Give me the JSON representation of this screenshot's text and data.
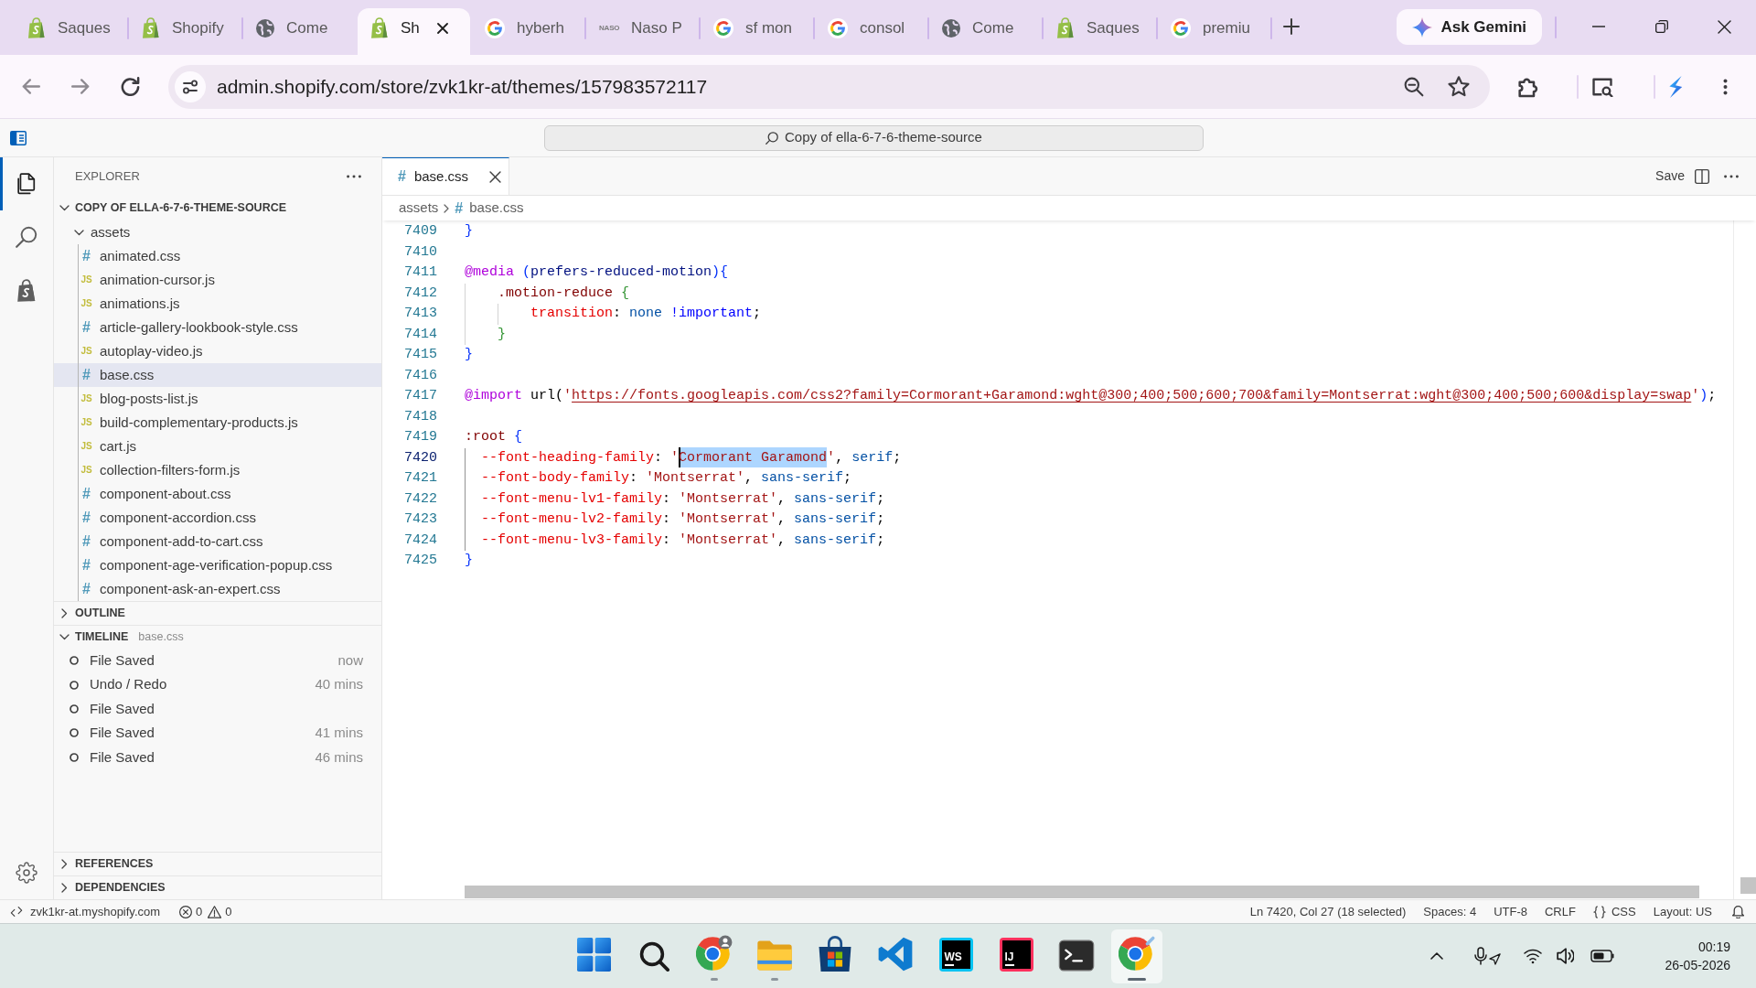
{
  "browser": {
    "tabs": [
      {
        "kind": "shopify",
        "title": "Saques",
        "selected": false
      },
      {
        "kind": "shopify",
        "title": "Shopify",
        "selected": false
      },
      {
        "kind": "globe",
        "title": "Come",
        "selected": false
      },
      {
        "kind": "shopify",
        "title": "Sh",
        "selected": true
      },
      {
        "kind": "google",
        "title": "hyberh",
        "selected": false
      },
      {
        "kind": "wordmark",
        "logo_text": "NASO",
        "title": "Naso P",
        "selected": false
      },
      {
        "kind": "google",
        "title": "sf mon",
        "selected": false
      },
      {
        "kind": "google",
        "title": "consol",
        "selected": false
      },
      {
        "kind": "globe",
        "title": "Come",
        "selected": false
      },
      {
        "kind": "shopify",
        "title": "Saques",
        "selected": false
      },
      {
        "kind": "google",
        "title": "premiu",
        "selected": false
      }
    ],
    "gemini_button": "Ask Gemini",
    "navigation": [
      {
        "kind": "back",
        "disabled": true
      },
      {
        "kind": "forward",
        "disabled": true
      },
      {
        "kind": "reload",
        "disabled": false
      }
    ],
    "address": "admin.shopify.com/store/zvk1kr-at/themes/157983572117"
  },
  "title_bar": {
    "search": "Copy of ella-6-7-6-theme-source"
  },
  "activity_bar": [
    {
      "kind": "explorer",
      "selected": true
    },
    {
      "kind": "search",
      "selected": false
    },
    {
      "kind": "store",
      "selected": false
    }
  ],
  "sidebar": {
    "title": "EXPLORER",
    "tree": {
      "name": "COPY OF ELLA-6-7-6-THEME-SOURCE",
      "expanded": true,
      "children": [
        {
          "name": "assets",
          "expanded": true,
          "children": [
            {
              "name": "animated.css",
              "kind": "css",
              "glyph": "#",
              "selected": false
            },
            {
              "name": "animation-cursor.js",
              "kind": "js",
              "glyph": "JS",
              "selected": false
            },
            {
              "name": "animations.js",
              "kind": "js",
              "glyph": "JS",
              "selected": false
            },
            {
              "name": "article-gallery-lookbook-style.css",
              "kind": "css",
              "glyph": "#",
              "selected": false
            },
            {
              "name": "autoplay-video.js",
              "kind": "js",
              "glyph": "JS",
              "selected": false
            },
            {
              "name": "base.css",
              "kind": "css",
              "glyph": "#",
              "selected": true
            },
            {
              "name": "blog-posts-list.js",
              "kind": "js",
              "glyph": "JS",
              "selected": false
            },
            {
              "name": "build-complementary-products.js",
              "kind": "js",
              "glyph": "JS",
              "selected": false
            },
            {
              "name": "cart.js",
              "kind": "js",
              "glyph": "JS",
              "selected": false
            },
            {
              "name": "collection-filters-form.js",
              "kind": "js",
              "glyph": "JS",
              "selected": false
            },
            {
              "name": "component-about.css",
              "kind": "css",
              "glyph": "#",
              "selected": false
            },
            {
              "name": "component-accordion.css",
              "kind": "css",
              "glyph": "#",
              "selected": false
            },
            {
              "name": "component-add-to-cart.css",
              "kind": "css",
              "glyph": "#",
              "selected": false
            },
            {
              "name": "component-age-verification-popup.css",
              "kind": "css",
              "glyph": "#",
              "selected": false
            },
            {
              "name": "component-ask-an-expert.css",
              "kind": "css",
              "glyph": "#",
              "selected": false
            }
          ]
        }
      ]
    },
    "sections": [
      {
        "title": "OUTLINE",
        "expanded": false
      },
      {
        "title": "TIMELINE",
        "subtitle": "base.css",
        "expanded": true,
        "items": [
          {
            "label": "File Saved",
            "time": "now"
          },
          {
            "label": "Undo / Redo",
            "time": "40 mins"
          },
          {
            "label": "File Saved"
          },
          {
            "label": "File Saved",
            "time": "41 mins"
          },
          {
            "label": "File Saved",
            "time": "46 mins"
          }
        ]
      },
      {
        "title": "REFERENCES",
        "expanded": false
      },
      {
        "title": "DEPENDENCIES",
        "expanded": false
      }
    ]
  },
  "editor": {
    "tabs": [
      {
        "title": "base.css",
        "kind": "css",
        "glyph": "#",
        "selected": true
      }
    ],
    "save_button": "Save",
    "breadcrumb": [
      {
        "text": "assets",
        "kind": "folder"
      },
      {
        "text": "base.css",
        "kind": "css",
        "glyph": "#"
      }
    ],
    "lines": [
      {
        "number": "7409",
        "current": false,
        "tokens": [
          {
            "text": "}",
            "kind": "bracket1"
          }
        ]
      },
      {
        "number": "7410",
        "current": false
      },
      {
        "number": "7411",
        "current": false,
        "tokens": [
          {
            "text": "@media",
            "kind": "at-rule"
          },
          {
            "text": " (",
            "kind": "bracket1"
          },
          {
            "text": "prefers-reduced-motion",
            "kind": "ident"
          },
          {
            "text": ")",
            "kind": "bracket1"
          },
          {
            "text": "{",
            "kind": "bracket1"
          }
        ]
      },
      {
        "number": "7412",
        "current": false,
        "tokens": [
          {
            "text": "    .motion-reduce ",
            "kind": "selector"
          },
          {
            "text": "{",
            "kind": "bracket2"
          }
        ]
      },
      {
        "number": "7413",
        "current": false,
        "tokens": [
          {
            "text": "        transition",
            "kind": "property"
          },
          {
            "text": ": ",
            "kind": "punct"
          },
          {
            "text": "none ",
            "kind": "value"
          },
          {
            "text": "!important",
            "kind": "keyword"
          },
          {
            "text": ";",
            "kind": "punct"
          }
        ]
      },
      {
        "number": "7414",
        "current": false,
        "tokens": [
          {
            "text": "    }",
            "kind": "bracket2"
          }
        ]
      },
      {
        "number": "7415",
        "current": false,
        "tokens": [
          {
            "text": "}",
            "kind": "bracket1"
          }
        ]
      },
      {
        "number": "7416",
        "current": false
      },
      {
        "number": "7417",
        "current": false,
        "tokens": [
          {
            "text": "@import",
            "kind": "at-rule"
          },
          {
            "text": " url(",
            "kind": "punct"
          },
          {
            "text": "'",
            "kind": "string"
          },
          {
            "text": "https://fonts.googleapis.com/css2?family=Cormorant+Garamond:wght@300;400;500;600;700&family=Montserrat:wght@300;400;500;600&display=swap",
            "kind": "link"
          },
          {
            "text": "'",
            "kind": "string"
          },
          {
            "text": ")",
            "kind": "bracket1"
          },
          {
            "text": ";",
            "kind": "punct"
          }
        ]
      },
      {
        "number": "7418",
        "current": false
      },
      {
        "number": "7419",
        "current": false,
        "tokens": [
          {
            "text": ":root ",
            "kind": "selector"
          },
          {
            "text": "{",
            "kind": "bracket1"
          }
        ]
      },
      {
        "number": "7420",
        "current": true,
        "tokens": [
          {
            "text": "  --font-heading-family",
            "kind": "property",
            "selected": false
          },
          {
            "text": ": ",
            "kind": "punct",
            "selected": false
          },
          {
            "text": "'",
            "kind": "string",
            "selected": false
          },
          {
            "text": "Cormorant Garamond",
            "kind": "string",
            "selected": true
          },
          {
            "text": "'",
            "kind": "string",
            "selected": false
          },
          {
            "text": ", ",
            "kind": "punct",
            "selected": false
          },
          {
            "text": "serif",
            "kind": "value",
            "selected": false
          },
          {
            "text": ";",
            "kind": "punct",
            "selected": false
          }
        ]
      },
      {
        "number": "7421",
        "current": false,
        "tokens": [
          {
            "text": "  --font-body-family",
            "kind": "property"
          },
          {
            "text": ": ",
            "kind": "punct"
          },
          {
            "text": "'Montserrat'",
            "kind": "string"
          },
          {
            "text": ", ",
            "kind": "punct"
          },
          {
            "text": "sans-serif",
            "kind": "value"
          },
          {
            "text": ";",
            "kind": "punct"
          }
        ]
      },
      {
        "number": "7422",
        "current": false,
        "tokens": [
          {
            "text": "  --font-menu-lv1-family",
            "kind": "property"
          },
          {
            "text": ": ",
            "kind": "punct"
          },
          {
            "text": "'Montserrat'",
            "kind": "string"
          },
          {
            "text": ", ",
            "kind": "punct"
          },
          {
            "text": "sans-serif",
            "kind": "value"
          },
          {
            "text": ";",
            "kind": "punct"
          }
        ]
      },
      {
        "number": "7423",
        "current": false,
        "tokens": [
          {
            "text": "  --font-menu-lv2-family",
            "kind": "property"
          },
          {
            "text": ": ",
            "kind": "punct"
          },
          {
            "text": "'Montserrat'",
            "kind": "string"
          },
          {
            "text": ", ",
            "kind": "punct"
          },
          {
            "text": "sans-serif",
            "kind": "value"
          },
          {
            "text": ";",
            "kind": "punct"
          }
        ]
      },
      {
        "number": "7424",
        "current": false,
        "tokens": [
          {
            "text": "  --font-menu-lv3-family",
            "kind": "property"
          },
          {
            "text": ": ",
            "kind": "punct"
          },
          {
            "text": "'Montserrat'",
            "kind": "string"
          },
          {
            "text": ", ",
            "kind": "punct"
          },
          {
            "text": "sans-serif",
            "kind": "value"
          },
          {
            "text": ";",
            "kind": "punct"
          }
        ]
      },
      {
        "number": "7425",
        "current": false,
        "tokens": [
          {
            "text": "}",
            "kind": "bracket1"
          }
        ]
      }
    ]
  },
  "status_bar": {
    "remote": "zvk1kr-at.myshopify.com",
    "errors": "0",
    "warnings": "0",
    "items": [
      {
        "kind": "text",
        "text": "Ln 7420, Col 27 (18 selected)"
      },
      {
        "kind": "text",
        "text": "Spaces: 4"
      },
      {
        "kind": "text",
        "text": "UTF-8"
      },
      {
        "kind": "text",
        "text": "CRLF"
      },
      {
        "kind": "language",
        "text": "CSS"
      },
      {
        "kind": "text",
        "text": "Layout: US"
      }
    ]
  },
  "taskbar": {
    "apps": [
      {
        "kind": "start",
        "running": false,
        "selected": false
      },
      {
        "kind": "search",
        "running": false,
        "selected": false
      },
      {
        "kind": "browser-profile",
        "running": true,
        "selected": false
      },
      {
        "kind": "files",
        "running": true,
        "selected": false
      },
      {
        "kind": "store",
        "running": false,
        "selected": false
      },
      {
        "kind": "code",
        "running": false,
        "selected": false
      },
      {
        "kind": "jetbrains",
        "label": "WS",
        "color": "#07c3f2",
        "running": false,
        "selected": false
      },
      {
        "kind": "jetbrains",
        "label": "IJ",
        "color": "#fe315d",
        "running": false,
        "selected": false
      },
      {
        "kind": "terminal",
        "running": false,
        "selected": false
      },
      {
        "kind": "browser",
        "running": true,
        "selected": true
      }
    ],
    "time": "00:19",
    "date": "26-05-2026"
  }
}
